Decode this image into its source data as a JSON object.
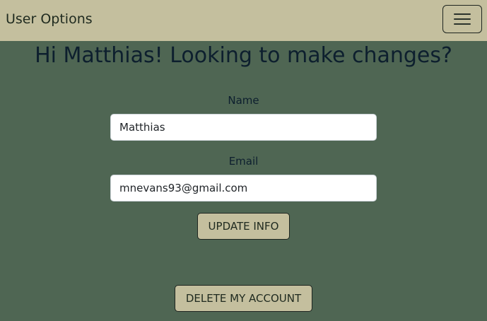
{
  "navbar": {
    "brand": "User Options",
    "menu_icon": "hamburger-icon"
  },
  "main": {
    "greeting": "Hi Matthias! Looking to make changes?",
    "name_label": "Name",
    "name_value": "Matthias",
    "email_label": "Email",
    "email_value": "mnevans93@gmail.com",
    "update_button": "UPDATE INFO",
    "delete_button": "DELETE MY ACCOUNT"
  },
  "colors": {
    "navbar_bg": "#c4bf9e",
    "page_bg": "#4f6653",
    "heading_text": "#0d1f2e",
    "button_bg": "#c4bf9e"
  }
}
